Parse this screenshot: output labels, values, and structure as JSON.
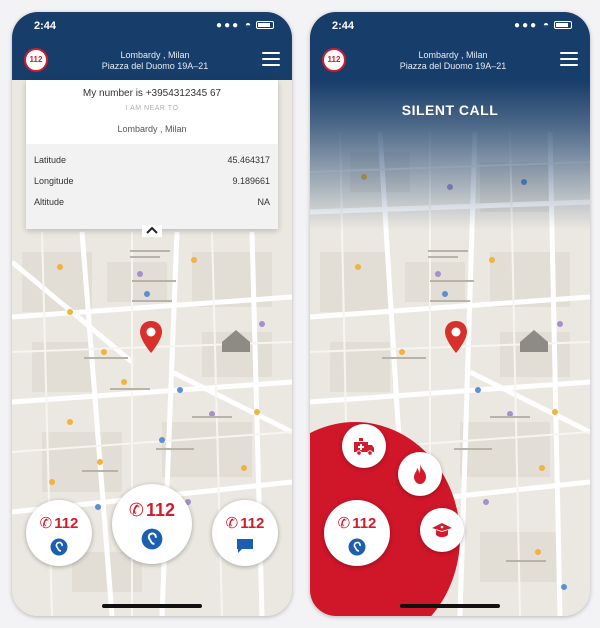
{
  "status": {
    "time": "2:44",
    "signal": "●●● ◓"
  },
  "header": {
    "logo_text": "112",
    "address_line1": "Lombardy , Milan",
    "address_line2": "Piazza del Duomo 19A–21"
  },
  "info_card": {
    "my_number": "My number is +3954312345 67",
    "near_label": "I AM NEAR TO",
    "near_value": "Lombardy , Milan",
    "rows": [
      {
        "label": "Latitude",
        "value": "45.464317"
      },
      {
        "label": "Longitude",
        "value": "9.189661"
      },
      {
        "label": "Altitude",
        "value": "NA"
      }
    ]
  },
  "silent_call": {
    "title": "SILENT CALL"
  },
  "call_buttons": {
    "left": {
      "number": "112",
      "sub_icon": "ear-icon"
    },
    "center": {
      "number": "112",
      "sub_icon": "ear-icon"
    },
    "right": {
      "number": "112",
      "sub_icon": "chat-icon"
    }
  },
  "right_call_button": {
    "number": "112",
    "sub_icon": "ear-icon"
  },
  "category_buttons": [
    "ambulance-icon",
    "fire-icon",
    "police-icon"
  ],
  "colors": {
    "header_navy": "#173d6a",
    "accent_red": "#d31b2c",
    "pin_red": "#d8302a",
    "map_bg": "#e9e6df"
  }
}
